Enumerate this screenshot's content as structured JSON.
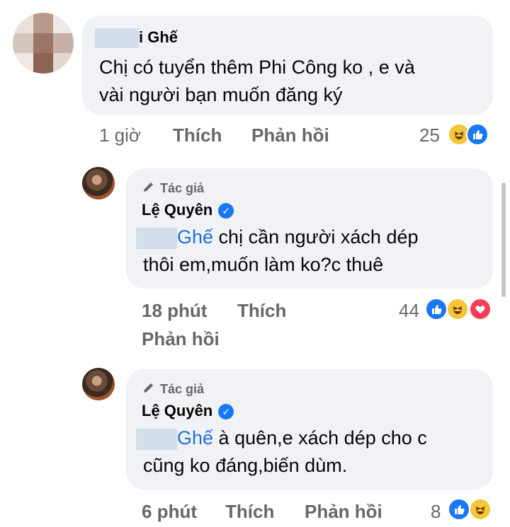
{
  "comments": [
    {
      "name_visible": "i Ghế",
      "text_lines": [
        "Chị có tuyển thêm Phi Công ko , e và",
        "vài người bạn muốn đăng ký"
      ],
      "time": "1 giờ",
      "like_label": "Thích",
      "reply_label": "Phản hồi",
      "reaction_count": "25",
      "reactions": [
        "haha-icon",
        "like-icon"
      ]
    }
  ],
  "replies": [
    {
      "author_badge": "Tác giả",
      "name": "Lệ Quyên",
      "mention": "Ghế",
      "text_first": " chị cần người xách dép",
      "text_second": "thôi em,muốn làm ko?c thuê",
      "time": "18 phút",
      "like_label": "Thích",
      "reply_label": "Phản hồi",
      "reaction_count": "44",
      "reactions": [
        "like-icon",
        "haha-icon",
        "love-icon"
      ]
    },
    {
      "author_badge": "Tác giả",
      "name": "Lệ Quyên",
      "mention": "Ghế",
      "text_first": " à quên,e xách dép cho c",
      "text_second": "cũng ko đáng,biến dùm.",
      "time": "6 phút",
      "like_label": "Thích",
      "reply_label": "Phản hồi",
      "reaction_count": "8",
      "reactions": [
        "like-icon",
        "haha-icon"
      ]
    }
  ],
  "colors": {
    "bubble": "#f0f2f5",
    "mention": "#216fdb",
    "muted": "#65676b",
    "like": "#1877f2",
    "haha": "#f7c53a",
    "love": "#f33e58"
  }
}
